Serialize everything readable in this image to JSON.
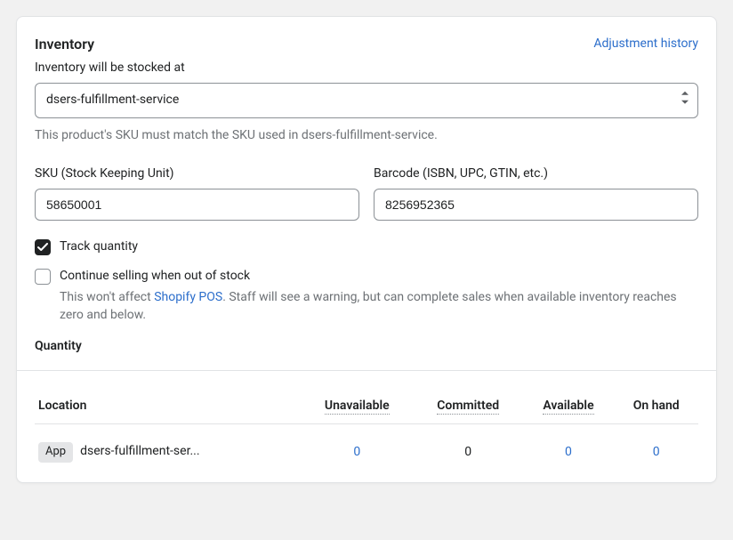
{
  "header": {
    "title": "Inventory",
    "adjustment_link": "Adjustment history"
  },
  "stock": {
    "label": "Inventory will be stocked at",
    "value": "dsers-fulfillment-service",
    "help": "This product's SKU must match the SKU used in dsers-fulfillment-service."
  },
  "sku": {
    "label": "SKU (Stock Keeping Unit)",
    "value": "58650001"
  },
  "barcode": {
    "label": "Barcode (ISBN, UPC, GTIN, etc.)",
    "value": "8256952365"
  },
  "track": {
    "label": "Track quantity"
  },
  "oversell": {
    "label": "Continue selling when out of stock",
    "help_prefix": "This won't affect ",
    "help_link": "Shopify POS",
    "help_suffix": ". Staff will see a warning, but can complete sales when available inventory reaches zero and below."
  },
  "quantity_heading": "Quantity",
  "table": {
    "headers": {
      "location": "Location",
      "unavailable": "Unavailable",
      "committed": "Committed",
      "available": "Available",
      "on_hand": "On hand"
    },
    "row": {
      "badge": "App",
      "name": "dsers-fulfillment-ser...",
      "unavailable": "0",
      "committed": "0",
      "available": "0",
      "on_hand": "0"
    }
  }
}
